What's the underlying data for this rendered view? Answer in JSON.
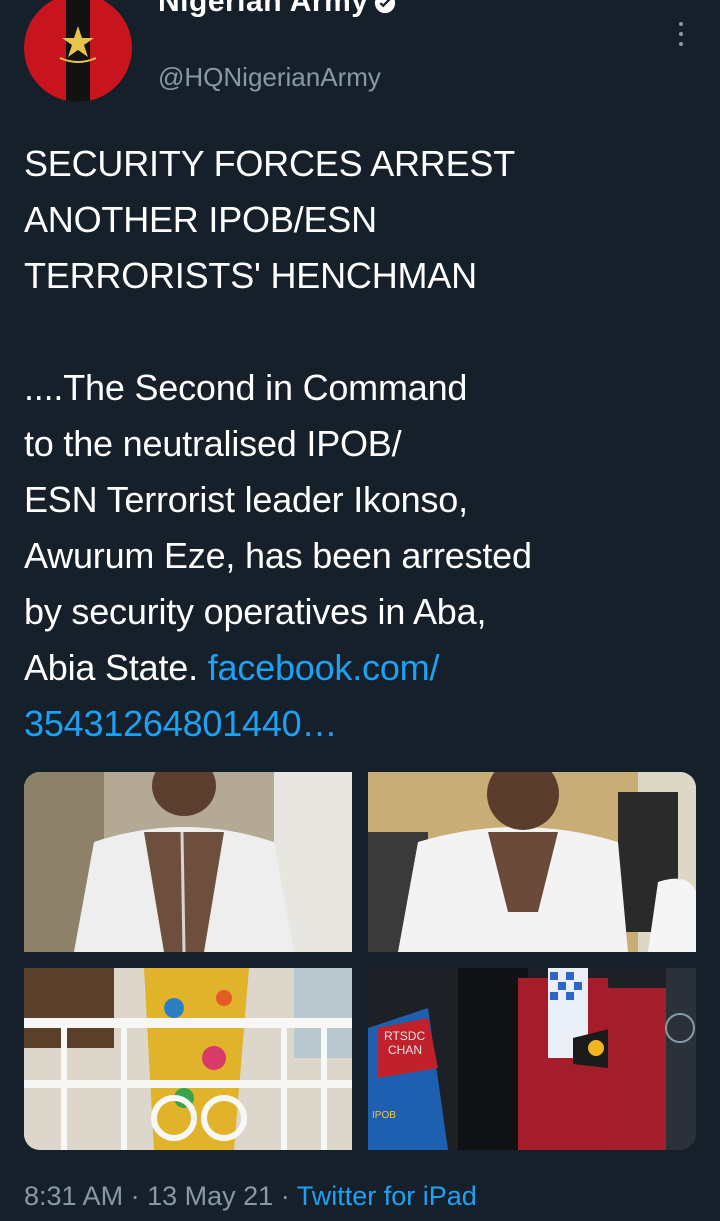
{
  "tweet": {
    "author_name": "Nigerian Army",
    "author_handle": "@HQNigerianArmy",
    "headline": "SECURITY FORCES ARREST\nANOTHER IPOB/ESN\nTERRORISTS' HENCHMAN",
    "body": "....The Second in Command\nto the neutralised IPOB/\nESN Terrorist leader Ikonso,\nAwurum Eze, has been arrested\nby security operatives in Aba,\nAbia State. ",
    "link_text": "facebook.com/\n35431264801440…",
    "time": "8:31 AM",
    "date": "13 May 21",
    "source": "Twitter for iPad",
    "media": [
      {
        "alt": "Man in white shirt standing indoors"
      },
      {
        "alt": "Man in white shirt seated"
      },
      {
        "alt": "Man in colorful print outfit on balcony"
      },
      {
        "alt": "Group of people in traditional attire"
      }
    ]
  },
  "overflow_texts": [
    "RTSDC",
    "CHAN",
    "IPOB"
  ],
  "colors": {
    "background": "#15202b",
    "text": "#ffffff",
    "secondary_text": "#8899a6",
    "link": "#1da1f2",
    "avatar_red": "#c8141d"
  },
  "icons": {
    "verified": "verified-badge-icon",
    "more": "more-options-icon"
  }
}
